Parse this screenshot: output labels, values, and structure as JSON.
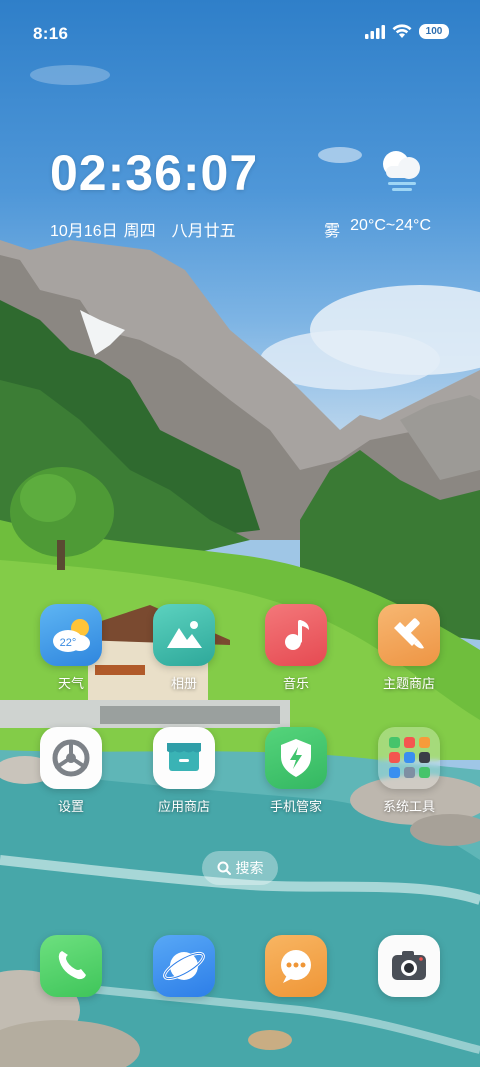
{
  "status_bar": {
    "time": "8:16",
    "battery": "100",
    "icons": [
      "signal-icon",
      "wifi-icon",
      "battery-icon"
    ]
  },
  "clock_widget": {
    "time": "02:36:07",
    "date": "10月16日",
    "weekday": "周四",
    "lunar_date": "八月廿五",
    "weather_condition": "雾",
    "temperature_range": "20°C~24°C",
    "weather_icon": "fog-cloud-icon"
  },
  "apps": [
    {
      "label": "天气",
      "icon": "weather-app-icon",
      "badge_text": "22°",
      "color": "#3d9be9"
    },
    {
      "label": "相册",
      "icon": "gallery-icon",
      "color": "#3cb7a9"
    },
    {
      "label": "音乐",
      "icon": "music-icon",
      "color": "#ee5b5f"
    },
    {
      "label": "主题商店",
      "icon": "theme-store-icon",
      "color": "#f2a55d"
    },
    {
      "label": "设置",
      "icon": "settings-icon",
      "color": "#ffffff"
    },
    {
      "label": "应用商店",
      "icon": "app-store-icon",
      "color": "#ffffff"
    },
    {
      "label": "手机管家",
      "icon": "security-shield-icon",
      "color": "#40c46d"
    },
    {
      "label": "系统工具",
      "icon": "system-tools-folder-icon",
      "color": "#ffffff"
    }
  ],
  "search": {
    "label": "搜索",
    "icon": "search-icon"
  },
  "dock": [
    {
      "name": "phone",
      "icon": "phone-icon",
      "color": "#4cd264"
    },
    {
      "name": "browser",
      "icon": "browser-planet-icon",
      "color": "#3a8ff0"
    },
    {
      "name": "messages",
      "icon": "message-icon",
      "color": "#f4a24b"
    },
    {
      "name": "camera",
      "icon": "camera-icon",
      "color": "#ffffff"
    }
  ]
}
